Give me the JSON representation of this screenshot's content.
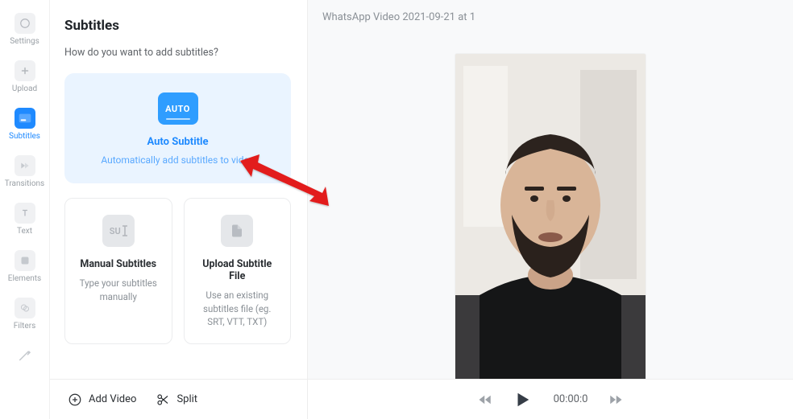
{
  "nav": {
    "items": [
      {
        "label": "Settings",
        "icon": "settings"
      },
      {
        "label": "Upload",
        "icon": "upload"
      },
      {
        "label": "Subtitles",
        "icon": "subtitles",
        "active": true
      },
      {
        "label": "Transitions",
        "icon": "transitions"
      },
      {
        "label": "Text",
        "icon": "text"
      },
      {
        "label": "Elements",
        "icon": "elements"
      },
      {
        "label": "Filters",
        "icon": "filters"
      },
      {
        "label": "Draw",
        "icon": "draw"
      }
    ]
  },
  "panel": {
    "title": "Subtitles",
    "subtitle": "How do you want to add subtitles?",
    "auto": {
      "badge": "AUTO",
      "title": "Auto Subtitle",
      "desc": "Automatically add subtitles to video"
    },
    "manual": {
      "icon_text": "SU",
      "title": "Manual Subtitles",
      "desc": "Type your subtitles manually"
    },
    "upload": {
      "title": "Upload Subtitle File",
      "desc": "Use an existing subtitles file (eg. SRT, VTT, TXT)"
    }
  },
  "preview": {
    "title": "WhatsApp Video 2021-09-21 at 1"
  },
  "toolbar": {
    "add_video": "Add Video",
    "split": "Split"
  },
  "player": {
    "time": "00:00:0"
  }
}
